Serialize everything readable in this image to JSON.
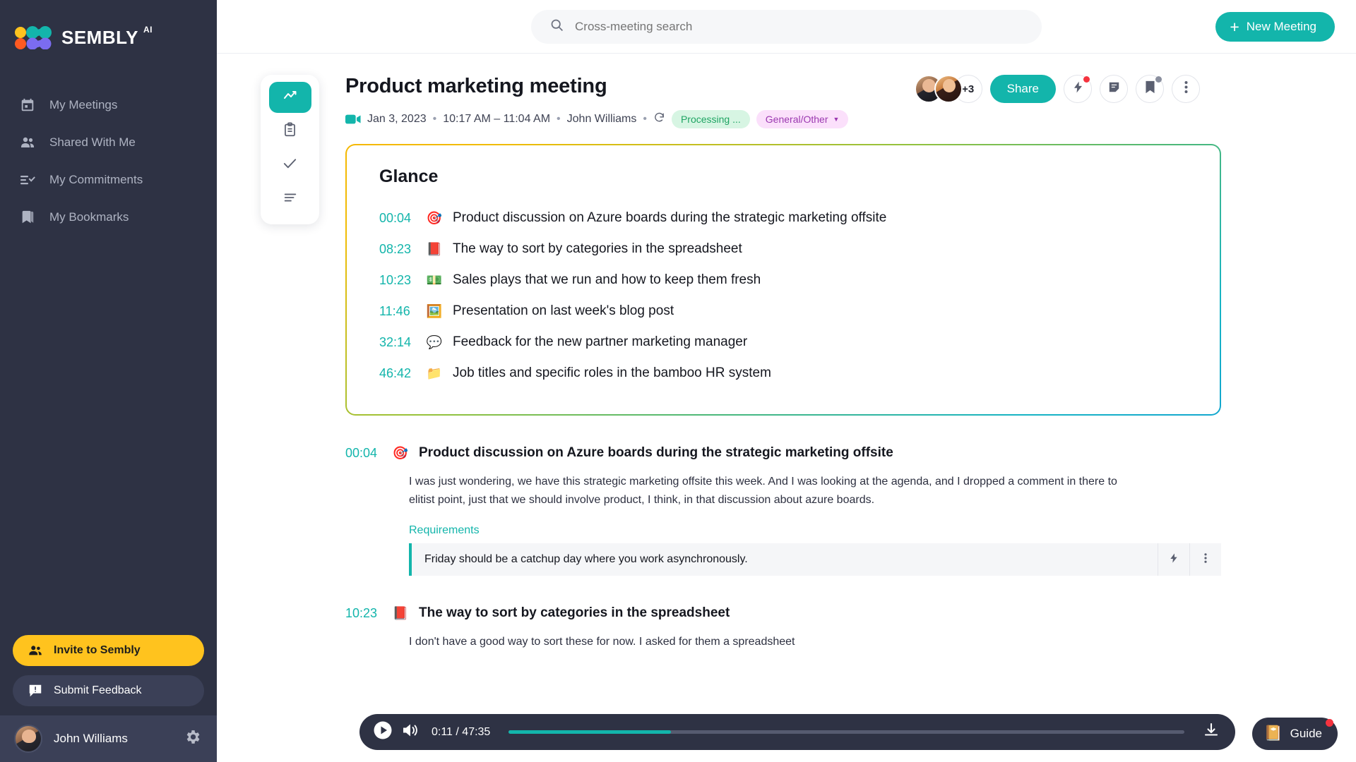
{
  "brand": {
    "name": "SEMBLY",
    "sup": "AI",
    "accent": "#13b5ab",
    "invite_yellow": "#ffc31e"
  },
  "sidebar": {
    "items": [
      {
        "label": "My Meetings",
        "icon": "calendar-icon"
      },
      {
        "label": "Shared With Me",
        "icon": "people-icon"
      },
      {
        "label": "My Commitments",
        "icon": "checklist-icon"
      },
      {
        "label": "My Bookmarks",
        "icon": "bookmark-icon"
      }
    ],
    "invite_label": "Invite to Sembly",
    "feedback_label": "Submit Feedback",
    "user_name": "John Williams"
  },
  "topbar": {
    "search_placeholder": "Cross-meeting search",
    "search_value": "",
    "new_meeting_label": "New Meeting",
    "plus": "+"
  },
  "rail": {
    "items": [
      {
        "name": "insights-tab",
        "icon": "trend-line-icon",
        "active": true
      },
      {
        "name": "notes-tab",
        "icon": "clipboard-icon",
        "active": false
      },
      {
        "name": "tasks-tab",
        "icon": "check-icon",
        "active": false
      },
      {
        "name": "transcript-tab",
        "icon": "text-lines-icon",
        "active": false
      }
    ]
  },
  "meeting": {
    "title": "Product marketing meeting",
    "date": "Jan 3, 2023",
    "time_range": "10:17 AM – 11:04 AM",
    "owner": "John Williams",
    "status_badge": "Processing ...",
    "category_badge": "General/Other",
    "avatar_overflow": "+3",
    "share_label": "Share"
  },
  "glance": {
    "title": "Glance",
    "items": [
      {
        "time": "00:04",
        "emoji": "🎯",
        "icon": "target-emoji",
        "text": "Product discussion on Azure boards during the strategic marketing offsite"
      },
      {
        "time": "08:23",
        "emoji": "📕",
        "icon": "closed-book-emoji",
        "text": "The way to sort by categories in the spreadsheet"
      },
      {
        "time": "10:23",
        "emoji": "💵",
        "icon": "dollar-banknote-emoji",
        "text": "Sales plays that we run and how to keep them fresh"
      },
      {
        "time": "11:46",
        "emoji": "🖼️",
        "icon": "framed-picture-emoji",
        "text": "Presentation on last week's blog post"
      },
      {
        "time": "32:14",
        "emoji": "💬",
        "icon": "speech-balloon-emoji",
        "text": "Feedback for the new partner marketing manager"
      },
      {
        "time": "46:42",
        "emoji": "📁",
        "icon": "folder-emoji",
        "text": "Job titles and specific roles in the bamboo HR system"
      }
    ]
  },
  "sections": [
    {
      "time": "00:04",
      "emoji": "🎯",
      "title": "Product discussion on Azure boards during the strategic marketing offsite",
      "body": "I was just wondering, we have this strategic marketing offsite this week. And I was looking at the agenda, and I dropped a comment in there to elitist point, just that we should involve product, I think, in that discussion about azure boards.",
      "label": "Requirements",
      "quote": "Friday should be a catchup day where you work asynchronously."
    },
    {
      "time": "10:23",
      "emoji": "📕",
      "title": "The way to sort by categories in the spreadsheet",
      "body": "I don't have a good way to sort these for now. I asked for them a spreadsheet",
      "label": "",
      "quote": ""
    }
  ],
  "player": {
    "current_time": "0:11",
    "separator": "/",
    "total_time": "47:35",
    "time_display": "0:11 / 47:35",
    "progress_percent": 24
  },
  "guide": {
    "label": "Guide",
    "emoji": "📔"
  }
}
